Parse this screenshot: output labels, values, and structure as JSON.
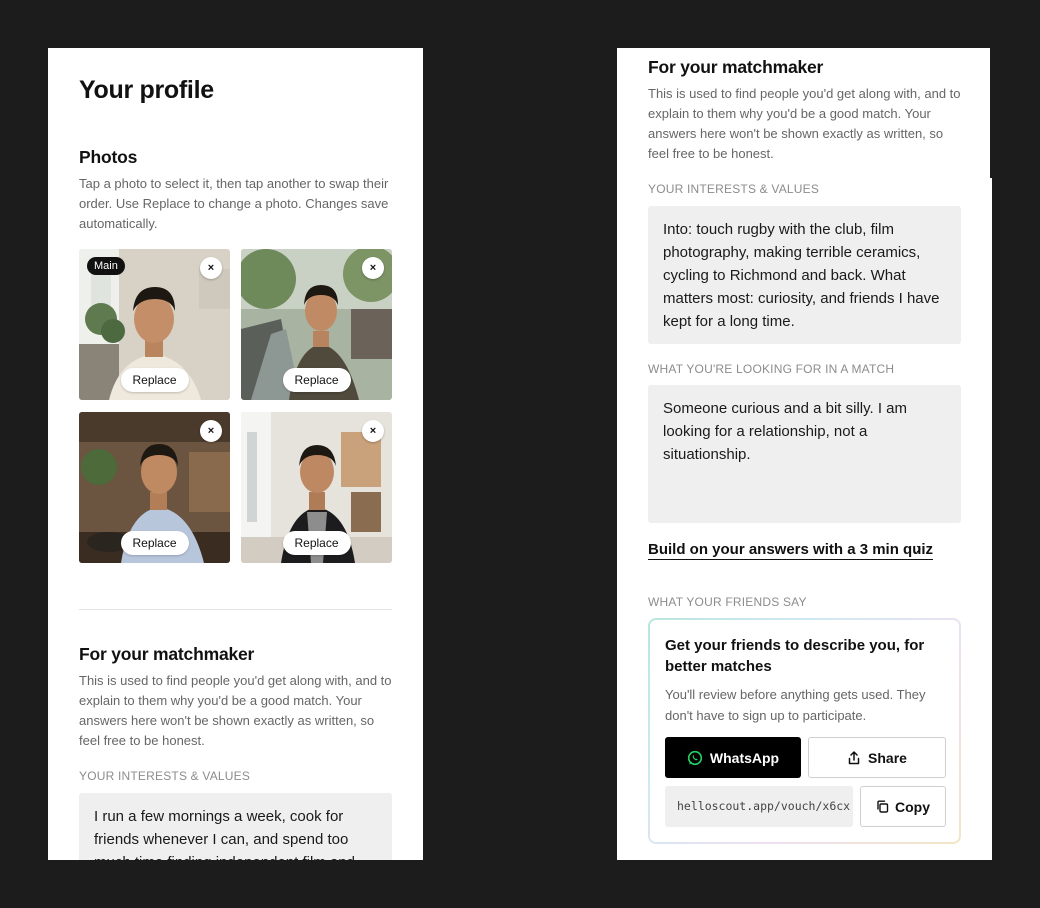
{
  "left": {
    "page_title": "Your profile",
    "photos": {
      "title": "Photos",
      "description": "Tap a photo to select it, then tap another to swap their order. Use Replace to change a photo. Changes save automatically.",
      "main_badge": "Main",
      "close_glyph": "×",
      "replace_label": "Replace"
    },
    "matchmaker": {
      "title": "For your matchmaker",
      "description": "This is used to find people you'd get along with, and to explain to them why you'd be a good match. Your answers here won't be shown exactly as written, so feel free to be honest.",
      "interests_label": "YOUR INTERESTS & VALUES",
      "interests_value": "I run a few mornings a week, cook for friends whenever I can, and spend too much time finding independent film and"
    }
  },
  "right": {
    "matchmaker": {
      "title": "For your matchmaker",
      "description": "This is used to find people you'd get along with, and to explain to them why you'd be a good match. Your answers here won't be shown exactly as written, so feel free to be honest.",
      "interests_label": "YOUR INTERESTS & VALUES",
      "interests_value": "Into: touch rugby with the club, film photography, making terrible ceramics, cycling to Richmond and back. What matters most: curiosity, and friends I have kept for a long time.",
      "looking_label": "WHAT YOU'RE LOOKING FOR IN A MATCH",
      "looking_value": "Someone curious and a bit silly. I am looking for a relationship, not a situationship.",
      "quiz_link": "Build on your answers with a 3 min quiz",
      "quiz_chevron": "›"
    },
    "friends": {
      "label": "WHAT YOUR FRIENDS SAY",
      "card_title": "Get your friends to describe you, for better matches",
      "card_subtitle": "You'll review before anything gets used. They don't have to sign up to participate.",
      "whatsapp_label": "WhatsApp",
      "share_label": "Share",
      "link_value": "helloscout.app/vouch/x6cx",
      "copy_label": "Copy"
    }
  },
  "colors": {
    "background": "#1c1c1c",
    "panel": "#ffffff",
    "textbox": "#efefef",
    "primary_button": "#000000",
    "whatsapp_green": "#25d366"
  },
  "icons": [
    "close-icon",
    "whatsapp-icon",
    "share-icon",
    "copy-icon",
    "chevron-right-icon"
  ]
}
